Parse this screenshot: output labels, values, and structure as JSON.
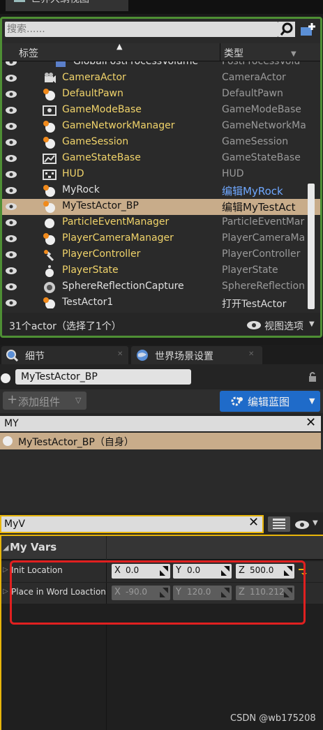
{
  "outliner": {
    "tab_title": "世界大纲视图",
    "search_placeholder": "搜索......",
    "col_label": "标签",
    "col_type": "类型",
    "rows": [
      {
        "name": "GlobalPostProcessVolume",
        "type": "PostProcessVolu"
      },
      {
        "name": "CameraActor",
        "type": "CameraActor"
      },
      {
        "name": "DefaultPawn",
        "type": "DefaultPawn"
      },
      {
        "name": "GameModeBase",
        "type": "GameModeBase"
      },
      {
        "name": "GameNetworkManager",
        "type": "GameNetworkMa"
      },
      {
        "name": "GameSession",
        "type": "GameSession"
      },
      {
        "name": "GameStateBase",
        "type": "GameStateBase"
      },
      {
        "name": "HUD",
        "type": "HUD"
      },
      {
        "name": "MyRock",
        "type": "编辑MyRock"
      },
      {
        "name": "MyTestActor_BP",
        "type": "编辑MyTestAct"
      },
      {
        "name": "ParticleEventManager",
        "type": "ParticleEventMar"
      },
      {
        "name": "PlayerCameraManager",
        "type": "PlayerCameraMa"
      },
      {
        "name": "PlayerController",
        "type": "PlayerController"
      },
      {
        "name": "PlayerState",
        "type": "PlayerState"
      },
      {
        "name": "SphereReflectionCapture",
        "type": "SphereReflection"
      },
      {
        "name": "TestActor1",
        "type": "打开TestActor"
      }
    ],
    "status": "31个actor（选择了1个）",
    "view_options": "视图选项"
  },
  "details": {
    "tab_details": "细节",
    "tab_world_settings": "世界场景设置",
    "actor_name": "MyTestActor_BP",
    "add_component": "添加组件",
    "edit_blueprint": "编辑蓝图",
    "component_search": "MY",
    "component_root": "MyTestActor_BP（自身）",
    "property_search": "MyV",
    "category": "My Vars",
    "properties": [
      {
        "label": "Init Location",
        "x": "0.0",
        "y": "0.0",
        "z": "500.0"
      },
      {
        "label": "Place in Word Loaction",
        "x": "-90.0",
        "y": "120.0",
        "z": "110.212"
      }
    ],
    "axis_x": "X",
    "axis_y": "Y",
    "axis_z": "Z"
  },
  "watermark": "CSDN @wb175208",
  "colors": {
    "outliner_border": "#4e8f34",
    "selection": "#c8ac8a",
    "actor_name": "#f0d36a",
    "link_type": "#6fa8ff",
    "blueprint_button": "#1f6bc9",
    "search_focus": "#e8b50a",
    "highlight": "#e02020"
  }
}
